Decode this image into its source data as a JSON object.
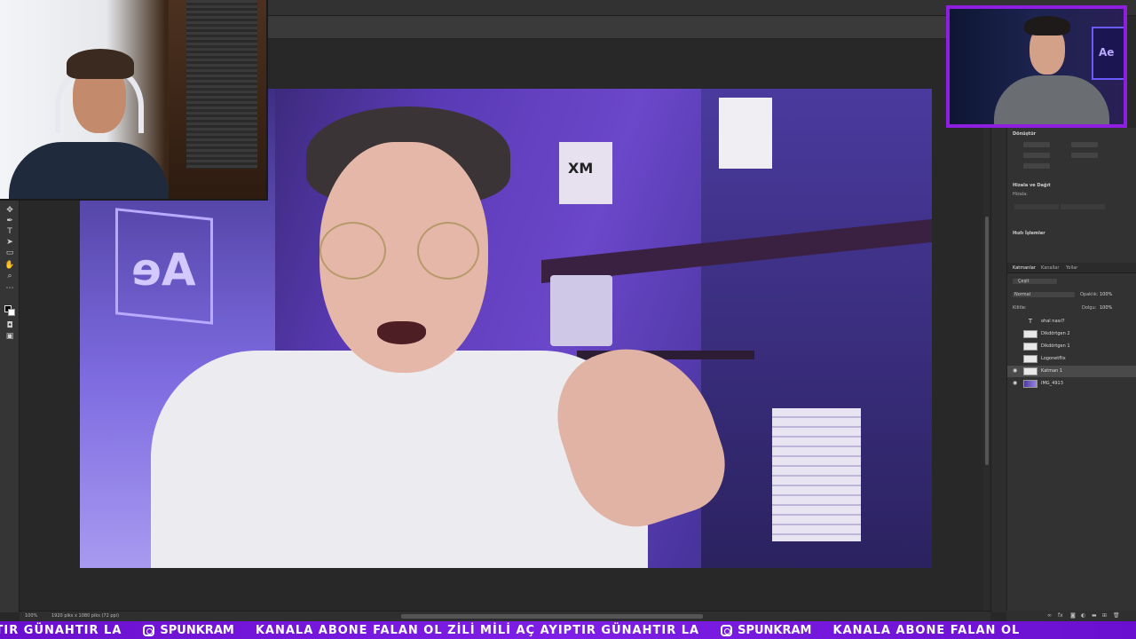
{
  "app": {
    "document_tab": "",
    "zoom": "100%",
    "doc_info": "1920 piks x 1080 piks (72 ppi)"
  },
  "toolbar": {
    "tools": [
      "move-tool-icon",
      "pen-tool-icon",
      "type-tool-icon",
      "path-select-icon",
      "rectangle-tool-icon",
      "hand-tool-icon",
      "zoom-tool-icon",
      "more-tools-icon"
    ]
  },
  "properties_panel": {
    "transform_title": "Dönüştür",
    "align_title": "Hizala ve Dağıt",
    "align_label": "Hizala:",
    "quick_actions_title": "Hızlı İşlemler"
  },
  "layers_panel": {
    "tabs": [
      "Katmanlar",
      "Kanallar",
      "Yollar"
    ],
    "active_tab": "Katmanlar",
    "filter": "Çeşit",
    "blend_mode": "Normal",
    "opacity_label": "Opaklık:",
    "opacity_value": "100%",
    "lock_label": "Kilitle:",
    "fill_label": "Dolgu:",
    "fill_value": "100%",
    "layers": [
      {
        "name": "ohal nasıl?",
        "kind": "text",
        "visible": false,
        "selected": false
      },
      {
        "name": "Dikdörtgen 2",
        "kind": "shape",
        "visible": false,
        "selected": false
      },
      {
        "name": "Dikdörtgen 1",
        "kind": "shape",
        "visible": false,
        "selected": false
      },
      {
        "name": "Logonetflix",
        "kind": "shape",
        "visible": false,
        "selected": false
      },
      {
        "name": "Katman 1",
        "kind": "shape",
        "visible": true,
        "selected": true
      },
      {
        "name": "IMG_4913",
        "kind": "image",
        "visible": true,
        "selected": false
      }
    ]
  },
  "canvas": {
    "ae_sign": "Ae",
    "box_label": "XM"
  },
  "webcam_right": {
    "screen_label": "Ae"
  },
  "ticker": {
    "segments": [
      {
        "type": "text",
        "value": "PTIR GÜNAHTIR LA"
      },
      {
        "type": "ig",
        "value": "SPUNKRAM"
      },
      {
        "type": "text",
        "value": "KANALA ABONE FALAN OL ZİLİ MİLİ AÇ AYIPTIR GÜNAHTIR LA"
      },
      {
        "type": "ig",
        "value": "SPUNKRAM"
      },
      {
        "type": "text",
        "value": "KANALA ABONE FALAN OL"
      }
    ]
  },
  "colors": {
    "ticker_bg": "#7e1ee6",
    "cam_border": "#8e1fe0",
    "ui_bg": "#282828"
  }
}
